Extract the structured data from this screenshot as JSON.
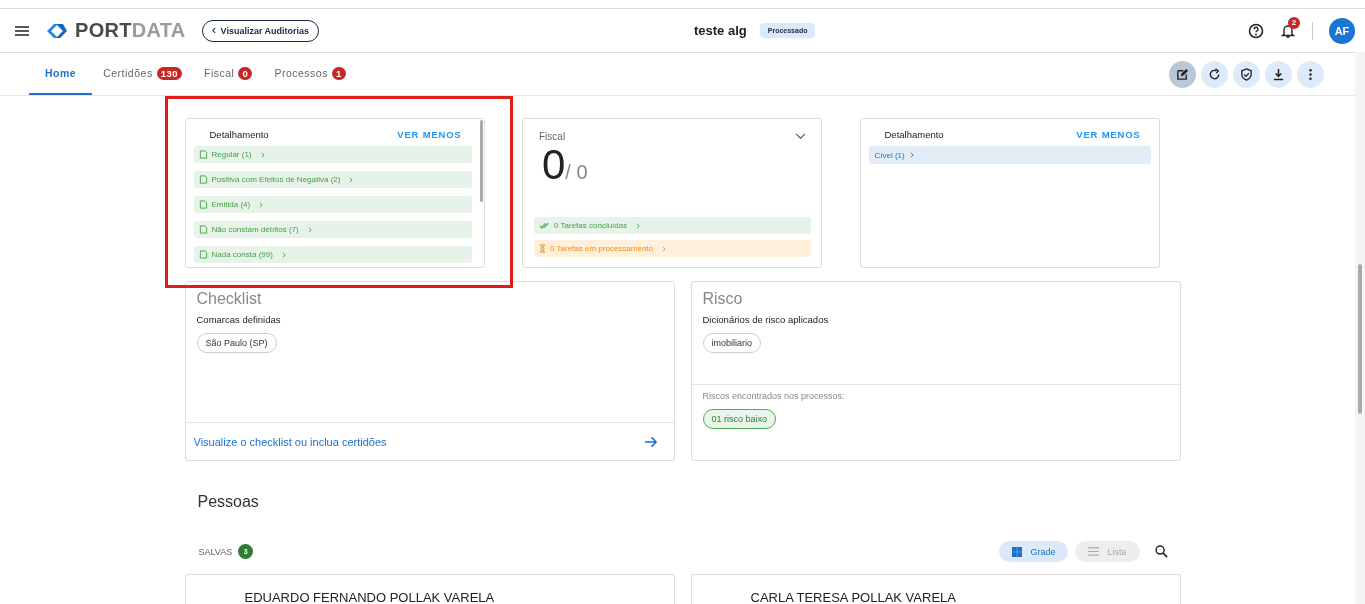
{
  "header": {
    "logo": {
      "part_1": "PORT",
      "part_2": "DATA"
    },
    "back_button": "Visualizar Auditorias",
    "title": "teste alg",
    "status": "Processado",
    "notifications": "2",
    "avatar": "AF"
  },
  "tabs": [
    {
      "label": "Home",
      "selected": true
    },
    {
      "label": "Certidões",
      "badge": "130",
      "selected": false
    },
    {
      "label": "Fiscal",
      "badge": "0",
      "selected": false
    },
    {
      "label": "Processos",
      "badge": "1",
      "selected": false
    }
  ],
  "toolbar": [
    {
      "kind": "edit",
      "selected": true
    },
    {
      "kind": "refresh",
      "selected": false
    },
    {
      "kind": "shield",
      "selected": false
    },
    {
      "kind": "download",
      "selected": false
    },
    {
      "kind": "more",
      "selected": false
    }
  ],
  "certidoes_card": {
    "title": "Detalhamento",
    "action": "VER MENOS",
    "items": [
      "Regular (1)",
      "Positiva com Efeitos de Negativa (2)",
      "Emitida (4)",
      "Não constam débitos (7)",
      "Nada consta (99)"
    ]
  },
  "fiscal_card": {
    "title": "Fiscal",
    "count": "0",
    "total": "/ 0",
    "tasks": [
      {
        "kind": "done",
        "label": "0 Tarefas concluídas"
      },
      {
        "kind": "pending",
        "label": "0 Tarefas em processamento"
      }
    ]
  },
  "processos_card": {
    "title": "Detalhamento",
    "action": "VER MENOS",
    "items": [
      "Cível (1)"
    ]
  },
  "checklist": {
    "title": "Checklist",
    "subtitle": "Comarcas definidas",
    "chips": [
      "São Paulo (SP)"
    ],
    "link": "Visualize o checklist ou inclua certidões"
  },
  "risco": {
    "title": "Risco",
    "subtitle": "Dicionários de risco aplicados",
    "chips": [
      "imobiliario"
    ],
    "found_label": "Riscos encontrados nos processos:",
    "found": [
      {
        "label": "01 risco baixo",
        "color": "#4caf50"
      }
    ]
  },
  "pessoas": {
    "title": "Pessoas",
    "saved_label": "SALVAS",
    "saved_count": "3",
    "views": [
      {
        "kind": "grid",
        "label": "Grade",
        "selected": true
      },
      {
        "kind": "list",
        "label": "Lista",
        "selected": false
      }
    ],
    "cards": [
      "EDUARDO FERNANDO POLLAK VARELA",
      "CARLA TERESA POLLAK VARELA"
    ]
  }
}
